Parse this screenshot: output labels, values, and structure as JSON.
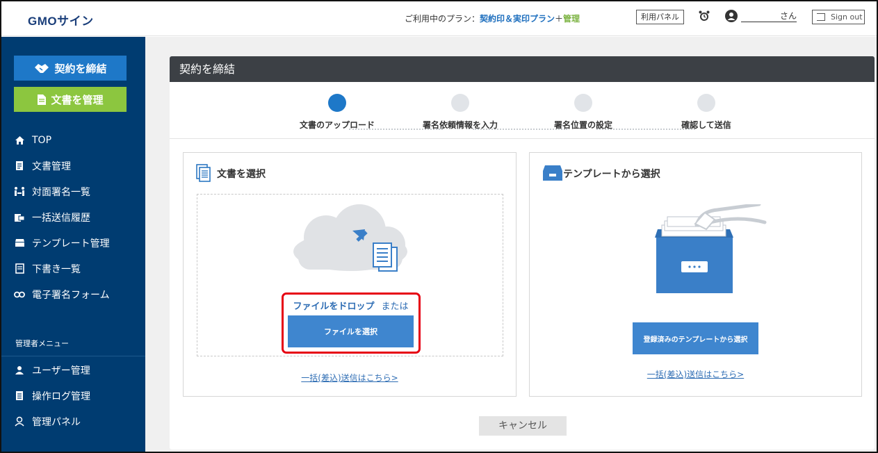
{
  "header": {
    "logo": "GMOサイン",
    "plan_prefix": "ご利用中のプラン：",
    "plan_name": "契約印＆実印プラン",
    "plan_plus": "＋",
    "plan_admin": "管理",
    "panel_button": "利用パネル",
    "user_suffix": "さん",
    "signout_label": "Sign out"
  },
  "sidebar": {
    "contract_button": "契約を締結",
    "manage_button": "文書を管理",
    "items": [
      {
        "label": "TOP",
        "icon": "home-icon"
      },
      {
        "label": "文書管理",
        "icon": "document-icon"
      },
      {
        "label": "対面署名一覧",
        "icon": "face-sign-icon"
      },
      {
        "label": "一括送信履歴",
        "icon": "bulk-send-icon"
      },
      {
        "label": "テンプレート管理",
        "icon": "template-icon"
      },
      {
        "label": "下書き一覧",
        "icon": "draft-icon"
      },
      {
        "label": "電子署名フォーム",
        "icon": "link-icon"
      }
    ],
    "admin_label": "管理者メニュー",
    "admin_items": [
      {
        "label": "ユーザー管理",
        "icon": "user-icon"
      },
      {
        "label": "操作ログ管理",
        "icon": "log-icon"
      },
      {
        "label": "管理パネル",
        "icon": "admin-panel-icon"
      }
    ]
  },
  "main": {
    "title": "契約を締結",
    "steps": [
      {
        "label": "文書のアップロード",
        "active": true
      },
      {
        "label": "署名依頼情報を入力",
        "active": false
      },
      {
        "label": "署名位置の設定",
        "active": false
      },
      {
        "label": "確認して送信",
        "active": false
      }
    ],
    "left_panel": {
      "title": "文書を選択",
      "drop_text": "ファイルをドロップ",
      "or_text": "または",
      "select_button": "ファイルを選択",
      "bulk_link": "一括(差込)送信はこちら>"
    },
    "right_panel": {
      "title": "テンプレートから選択",
      "select_button": "登録済みのテンプレートから選択",
      "bulk_link": "一括(差込)送信はこちら>"
    },
    "cancel_button": "キャンセル"
  },
  "colors": {
    "sidebar_bg": "#003c71",
    "primary_blue": "#1e78c8",
    "green": "#8cc63f",
    "highlight_red": "#e60012"
  }
}
